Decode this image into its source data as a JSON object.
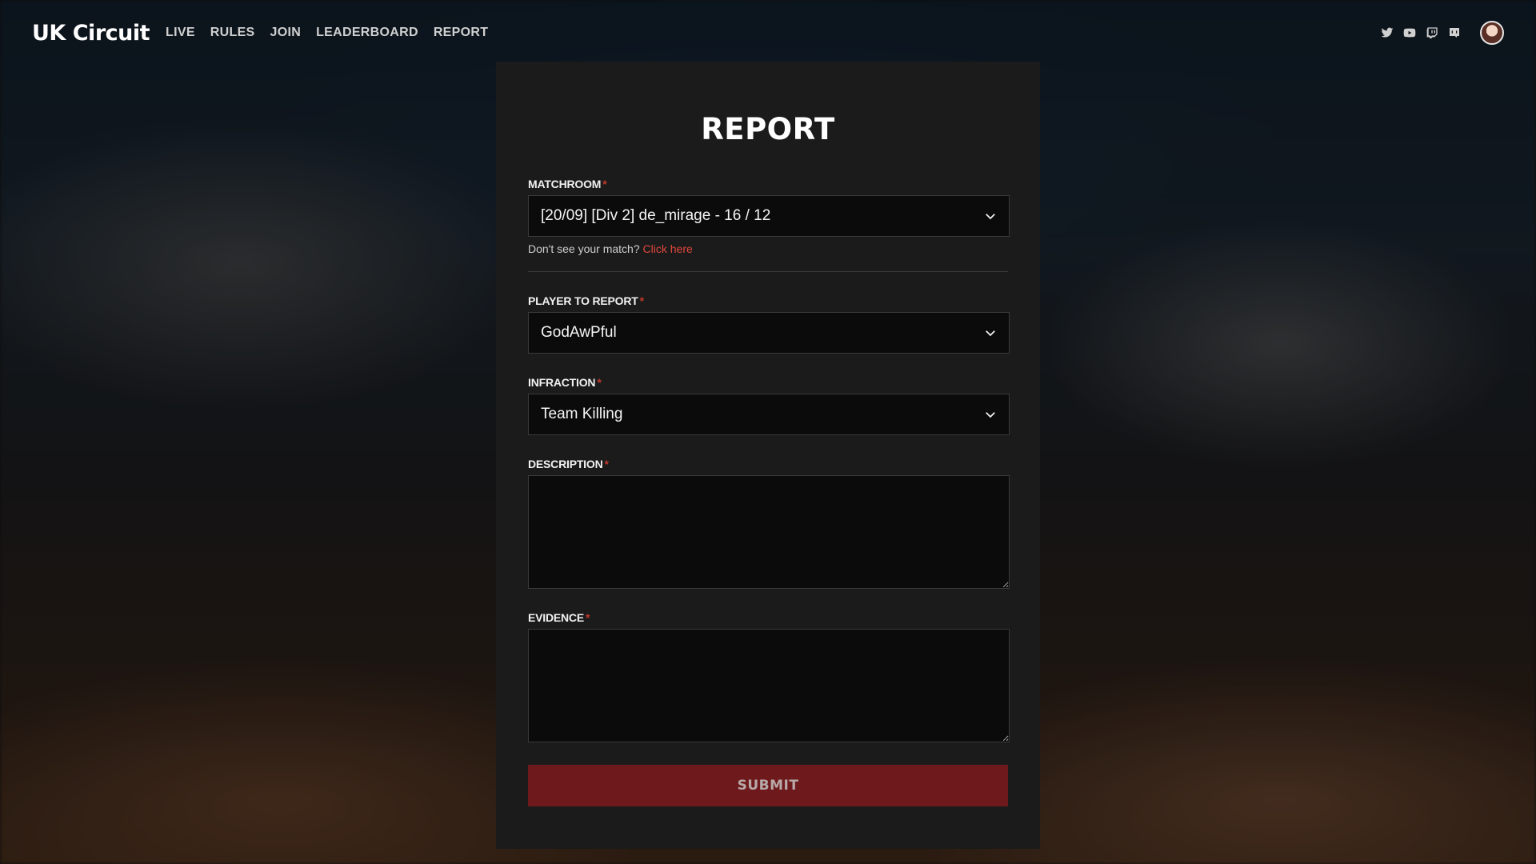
{
  "header": {
    "brand": "UK Circuit",
    "nav": [
      {
        "label": "LIVE"
      },
      {
        "label": "RULES"
      },
      {
        "label": "JOIN"
      },
      {
        "label": "LEADERBOARD"
      },
      {
        "label": "REPORT"
      }
    ],
    "social_icons": [
      "twitter-icon",
      "youtube-icon",
      "twitch-icon",
      "discord-icon"
    ]
  },
  "form": {
    "title": "REPORT",
    "required_marker": "*",
    "matchroom": {
      "label": "MATCHROOM",
      "value": "[20/09] [Div 2] de_mirage - 16 / 12",
      "hint_text": "Don't see your match?",
      "hint_link": "Click here"
    },
    "player": {
      "label": "PLAYER TO REPORT",
      "value": "GodAwPful"
    },
    "infraction": {
      "label": "INFRACTION",
      "value": "Team Killing"
    },
    "description": {
      "label": "DESCRIPTION",
      "value": ""
    },
    "evidence": {
      "label": "EVIDENCE",
      "value": ""
    },
    "submit_label": "SUBMIT"
  },
  "colors": {
    "accent_red": "#e0473c",
    "submit_bg": "#6e1a1c",
    "card_bg": "#1b1b1b"
  }
}
